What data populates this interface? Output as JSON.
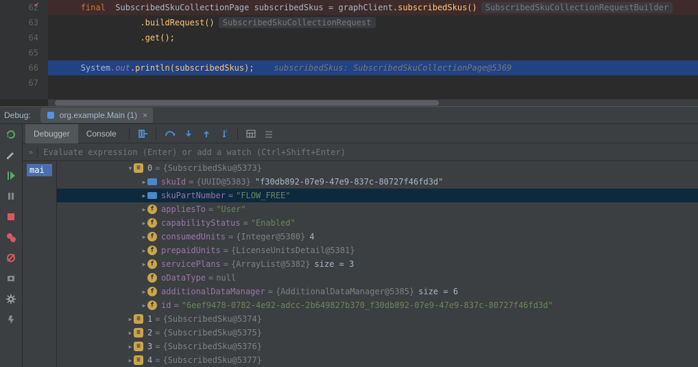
{
  "editor": {
    "lines": [
      "62",
      "63",
      "64",
      "65",
      "66",
      "67"
    ],
    "final_kw": "final",
    "type1": "SubscribedSkuCollectionPage",
    "var": "subscribedSkus",
    "eq": "=",
    "rhs_obj": "graphClient",
    "rhs_call1": ".subscribedSkus()",
    "hint1": "SubscribedSkuCollectionRequestBuilder",
    "buildReq": ".buildRequest()",
    "hint2": "SubscribedSkuCollectionRequest",
    "get": ".get();",
    "sys": "System",
    "out": ".out",
    "println": ".println(subscribedSkus);",
    "inlay": "subscribedSkus: SubscribedSkuCollectionPage@5369"
  },
  "debugbar": {
    "label": "Debug:",
    "tab": "org.example.Main (1)"
  },
  "tabrow": {
    "debugger": "Debugger",
    "console": "Console"
  },
  "eval": {
    "placeholder": "Evaluate expression (Enter) or add a watch (Ctrl+Shift+Enter)",
    "chev": "»"
  },
  "frames": {
    "item": "mai"
  },
  "vars": {
    "root": {
      "idx": "0",
      "eq": "=",
      "ref": "{SubscribedSku@5373}"
    },
    "skuId": {
      "name": "skuId",
      "eq": "=",
      "ref": "{UUID@5383}",
      "val": "\"f30db892-07e9-47e9-837c-80727f46fd3d\""
    },
    "skuPart": {
      "name": "skuPartNumber",
      "eq": "=",
      "val": "\"FLOW_FREE\""
    },
    "appliesTo": {
      "name": "appliesTo",
      "eq": "=",
      "val": "\"User\""
    },
    "capability": {
      "name": "capabilityStatus",
      "eq": "=",
      "val": "\"Enabled\""
    },
    "consumed": {
      "name": "consumedUnits",
      "eq": "=",
      "ref": "{Integer@5380}",
      "val": "4"
    },
    "prepaid": {
      "name": "prepaidUnits",
      "eq": "=",
      "ref": "{LicenseUnitsDetail@5381}"
    },
    "servicePlans": {
      "name": "servicePlans",
      "eq": "=",
      "ref": "{ArrayList@5382}",
      "size": "size = 3"
    },
    "oDataType": {
      "name": "oDataType",
      "eq": "=",
      "val": "null"
    },
    "adm": {
      "name": "additionalDataManager",
      "eq": "=",
      "ref": "{AdditionalDataManager@5385}",
      "size": "size = 6"
    },
    "id": {
      "name": "id",
      "eq": "=",
      "val": "\"6eef9478-0782-4e92-adcc-2b649827b370_f30db892-07e9-47e9-837c-80727f46fd3d\""
    },
    "i1": {
      "idx": "1",
      "eq": "=",
      "ref": "{SubscribedSku@5374}"
    },
    "i2": {
      "idx": "2",
      "eq": "=",
      "ref": "{SubscribedSku@5375}"
    },
    "i3": {
      "idx": "3",
      "eq": "=",
      "ref": "{SubscribedSku@5376}"
    },
    "i4": {
      "idx": "4",
      "eq": "=",
      "ref": "{SubscribedSku@5377}"
    }
  }
}
